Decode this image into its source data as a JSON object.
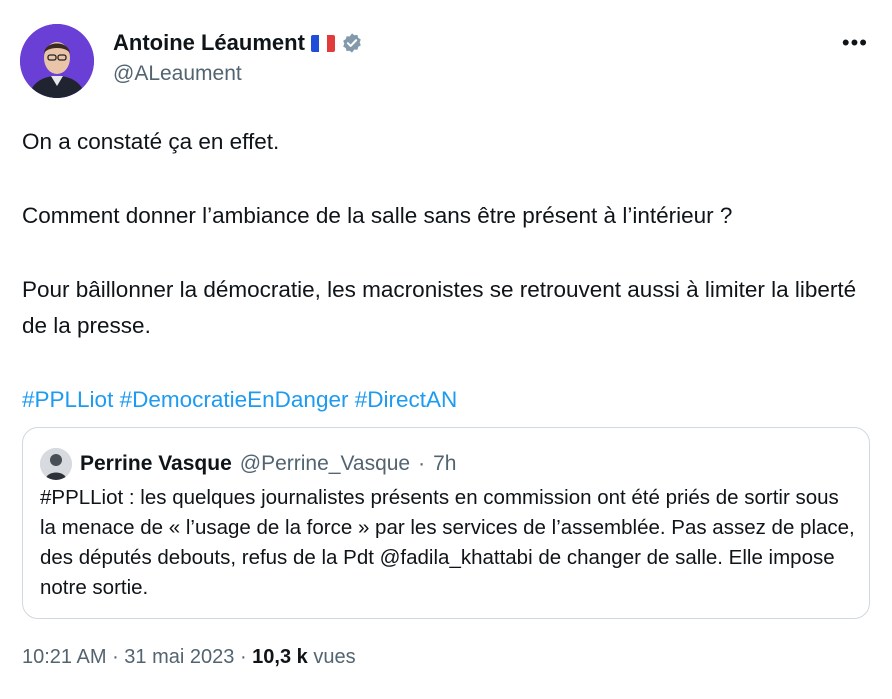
{
  "author": {
    "name": "Antoine Léaument",
    "handle": "@ALeaument",
    "avatar_color": "#6a3fd6"
  },
  "more_label": "•••",
  "tweet": {
    "line1": "On a constaté ça en effet.",
    "line2": "Comment donner l’ambiance de la salle sans être présent à l’intérieur ?",
    "line3": "Pour bâillonner la démocratie, les macronistes se retrouvent aussi à limiter la liberté de la presse.",
    "hashtags": [
      "#PPLLiot",
      "#DemocratieEnDanger",
      "#DirectAN"
    ]
  },
  "quote": {
    "name": "Perrine Vasque",
    "handle": "@Perrine_Vasque",
    "time": "7h",
    "text": "#PPLLiot : les quelques journalistes présents en commission ont été priés de sortir sous la menace de « l’usage de la force » par les services de l’assemblée. Pas assez de place, des députés debouts, refus de la Pdt @fadila_khattabi de changer de salle. Elle impose notre sortie."
  },
  "footer": {
    "time": "10:21 AM",
    "date": "31 mai 2023",
    "views_count": "10,3 k",
    "views_label": "vues"
  },
  "colors": {
    "link": "#1d9bf0",
    "secondary_text": "#536471",
    "border": "#cfd9de"
  }
}
